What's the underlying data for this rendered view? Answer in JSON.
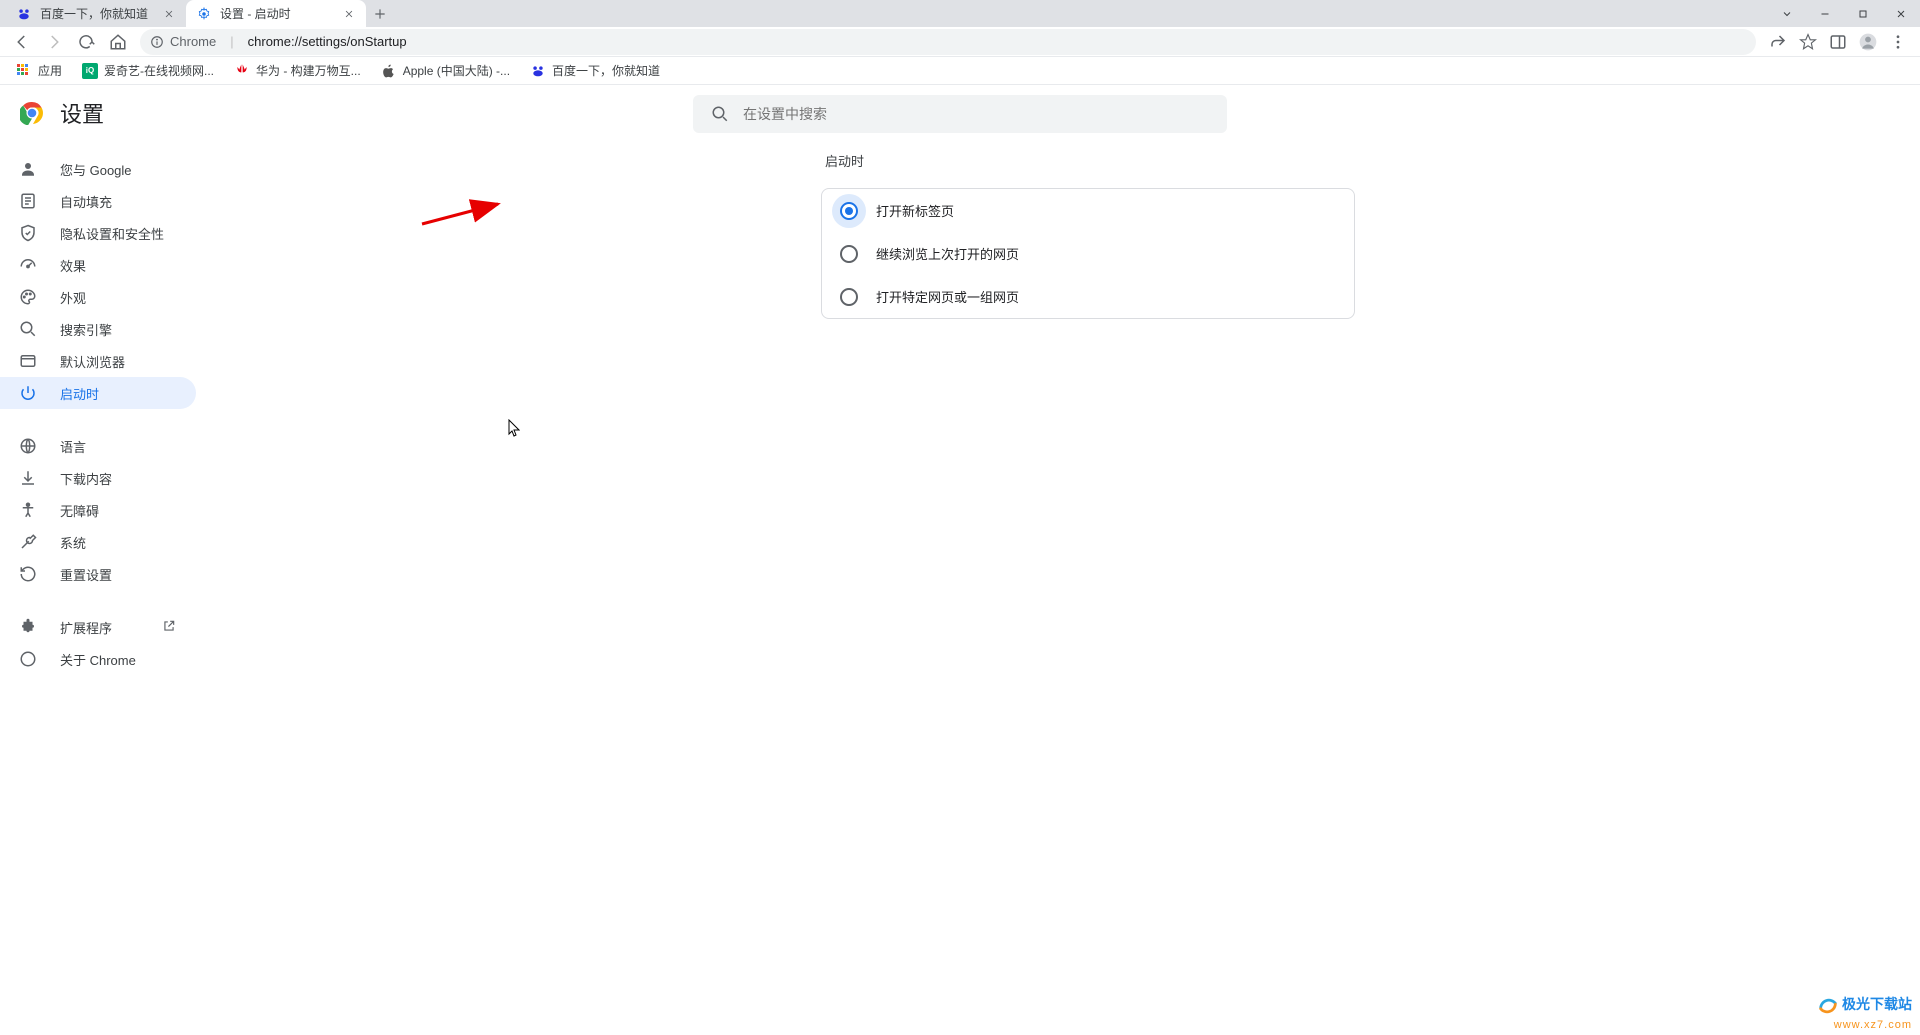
{
  "tabs": [
    {
      "title": "百度一下，你就知道",
      "favicon": "baidu"
    },
    {
      "title": "设置 - 启动时",
      "favicon": "settings"
    }
  ],
  "activeTabIndex": 1,
  "address": {
    "secureLabel": "Chrome",
    "url": "chrome://settings/onStartup"
  },
  "bookmarks": [
    {
      "label": "应用",
      "icon": "apps"
    },
    {
      "label": "爱奇艺-在线视频网...",
      "icon": "iqiyi"
    },
    {
      "label": "华为 - 构建万物互...",
      "icon": "huawei"
    },
    {
      "label": "Apple (中国大陆) -...",
      "icon": "apple"
    },
    {
      "label": "百度一下，你就知道",
      "icon": "baidu"
    }
  ],
  "settings": {
    "appTitle": "设置",
    "searchPlaceholder": "在设置中搜索",
    "sidebar": [
      {
        "label": "您与 Google",
        "icon": "person"
      },
      {
        "label": "自动填充",
        "icon": "autofill"
      },
      {
        "label": "隐私设置和安全性",
        "icon": "shield"
      },
      {
        "label": "效果",
        "icon": "speed"
      },
      {
        "label": "外观",
        "icon": "palette"
      },
      {
        "label": "搜索引擎",
        "icon": "search"
      },
      {
        "label": "默认浏览器",
        "icon": "browser"
      },
      {
        "label": "启动时",
        "icon": "power",
        "active": true
      }
    ],
    "sidebar2": [
      {
        "label": "语言",
        "icon": "globe"
      },
      {
        "label": "下载内容",
        "icon": "download"
      },
      {
        "label": "无障碍",
        "icon": "accessibility"
      },
      {
        "label": "系统",
        "icon": "wrench"
      },
      {
        "label": "重置设置",
        "icon": "restore"
      }
    ],
    "sidebar3": [
      {
        "label": "扩展程序",
        "icon": "extension",
        "external": true
      },
      {
        "label": "关于 Chrome",
        "icon": "info"
      }
    ],
    "sectionTitle": "启动时",
    "options": [
      {
        "label": "打开新标签页",
        "checked": true
      },
      {
        "label": "继续浏览上次打开的网页",
        "checked": false
      },
      {
        "label": "打开特定网页或一组网页",
        "checked": false
      }
    ]
  },
  "watermark": {
    "brand": "极光下载站",
    "url": "www.xz7.com"
  }
}
